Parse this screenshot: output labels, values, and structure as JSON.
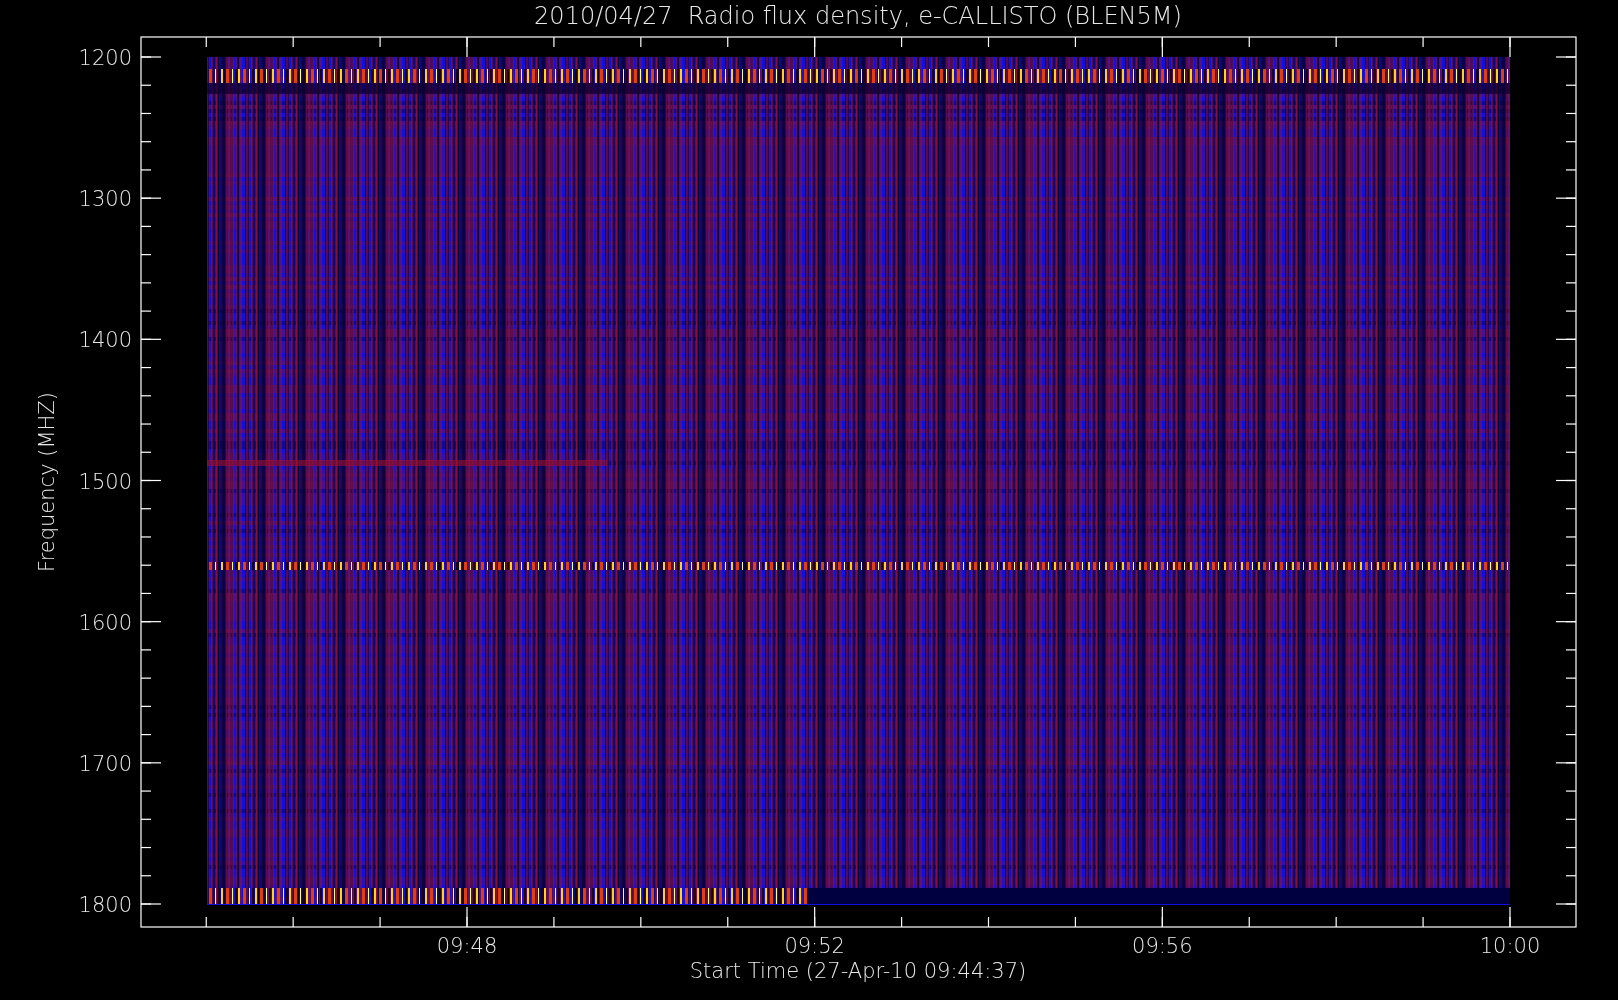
{
  "title": "2010/04/27  Radio flux density, e-CALLISTO (BLEN5M)",
  "y_axis": {
    "label": "Frequency (MHZ)",
    "ticks": [
      "1200",
      "1300",
      "1400",
      "1500",
      "1600",
      "1700",
      "1800"
    ]
  },
  "x_axis": {
    "label": "Start Time (27-Apr-10 09:44:37)",
    "ticks": [
      "09:48",
      "09:52",
      "09:56",
      "10:00"
    ]
  }
}
